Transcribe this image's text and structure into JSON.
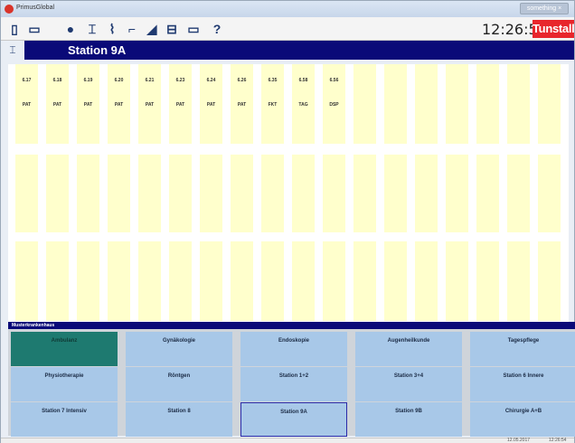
{
  "window": {
    "title": "PrimusGlobal",
    "controls_label": "something ×"
  },
  "toolbar": {
    "icons": [
      "door-icon",
      "window-icon",
      "ball-icon",
      "bed-icon",
      "call-icon",
      "stairs-icon",
      "stairs-alt-icon",
      "printer-icon",
      "tape-icon",
      "help-icon"
    ],
    "help_label": "?"
  },
  "clock": {
    "time": "12:26:54"
  },
  "brand": {
    "name": "Tunstall"
  },
  "station": {
    "name": "Station 9A"
  },
  "rooms": {
    "row1": [
      {
        "num": "6.17",
        "type": "PAT"
      },
      {
        "num": "6.18",
        "type": "PAT"
      },
      {
        "num": "6.19",
        "type": "PAT"
      },
      {
        "num": "6.20",
        "type": "PAT"
      },
      {
        "num": "6.21",
        "type": "PAT"
      },
      {
        "num": "6.23",
        "type": "PAT"
      },
      {
        "num": "6.24",
        "type": "PAT"
      },
      {
        "num": "6.26",
        "type": "PAT"
      },
      {
        "num": "6.35",
        "type": "FKT"
      },
      {
        "num": "6.58",
        "type": "TAG"
      },
      {
        "num": "6.56",
        "type": "DSP"
      },
      {
        "num": "",
        "type": ""
      },
      {
        "num": "",
        "type": ""
      },
      {
        "num": "",
        "type": ""
      },
      {
        "num": "",
        "type": ""
      },
      {
        "num": "",
        "type": ""
      },
      {
        "num": "",
        "type": ""
      },
      {
        "num": "",
        "type": ""
      }
    ]
  },
  "hospital": {
    "name": "Musterkrankenhaus"
  },
  "wards": [
    {
      "label": "Ambulanz",
      "state": "active"
    },
    {
      "label": "Gynäkologie",
      "state": ""
    },
    {
      "label": "Endoskopie",
      "state": ""
    },
    {
      "label": "Augenheilkunde",
      "state": ""
    },
    {
      "label": "Tagespflege",
      "state": ""
    },
    {
      "label": "Physiotherapie",
      "state": ""
    },
    {
      "label": "Röntgen",
      "state": ""
    },
    {
      "label": "Station 1+2",
      "state": ""
    },
    {
      "label": "Station 3+4",
      "state": ""
    },
    {
      "label": "Station 6 Innere",
      "state": ""
    },
    {
      "label": "Station 7 Intensiv",
      "state": ""
    },
    {
      "label": "Station 8",
      "state": ""
    },
    {
      "label": "Station 9A",
      "state": "selected"
    },
    {
      "label": "Station 9B",
      "state": ""
    },
    {
      "label": "Chirurgie A+B",
      "state": ""
    }
  ],
  "statusbar": {
    "date": "12.05.2017",
    "time": "12:26:54"
  }
}
